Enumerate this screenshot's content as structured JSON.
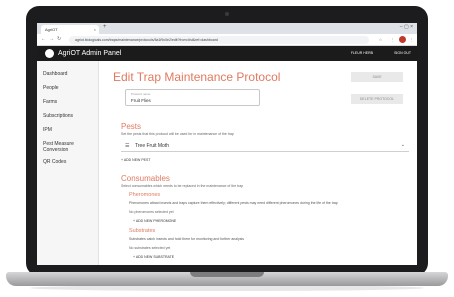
{
  "browser": {
    "tab_title": "AgriOT",
    "tab_close": "×",
    "new_tab": "+",
    "window_controls": "–  ▢  ×",
    "url": "agriot.biologicals.com/traps/maintenance/protocols/5a1f9c0e2/edit?from=list&ref=dashboard"
  },
  "app": {
    "title": "AgriOT Admin Panel",
    "user": "FLEUR HERB",
    "signout": "SIGN OUT"
  },
  "sidebar": {
    "items": [
      {
        "label": "Dashboard"
      },
      {
        "label": "People"
      },
      {
        "label": "Farms"
      },
      {
        "label": "Subscriptions"
      },
      {
        "label": "IPM"
      },
      {
        "label": "Pest Measure Conversion"
      },
      {
        "label": "QR Codes"
      }
    ]
  },
  "page": {
    "title": "Edit Trap Maintenance Protocol",
    "save_label": "SAVE",
    "delete_label": "DELETE PROTOCOL",
    "name_field": {
      "label": "Protocol name",
      "value": "Fruit Flies"
    }
  },
  "pests": {
    "title": "Pests",
    "subtitle": "Set the pests that this protocol will be used for in maintenance of the trap",
    "selected": "Tree Fruit Moth",
    "add_label": "+ ADD NEW PEST"
  },
  "consumables": {
    "title": "Consumables",
    "subtitle": "Select consumables which needs to be replaced in the maintenance of the trap",
    "pheromones": {
      "title": "Pheromones",
      "desc": "Pheromones attract insects and traps capture them effectively; different pests may need different pheromones during the life of the trap",
      "none_selected": "No pheromones selected yet",
      "add_label": "+ ADD NEW PHEROMONE"
    },
    "substrates": {
      "title": "Substrates",
      "desc": "Substrates catch insects and hold them for monitoring and further analysis",
      "none_selected": "No substrates selected yet",
      "add_label": "+ ADD NEW SUBSTRATE"
    }
  },
  "colors": {
    "accent": "#e07a5f",
    "appbar": "#1b1b1b",
    "laptop": "#1c1c1e"
  }
}
